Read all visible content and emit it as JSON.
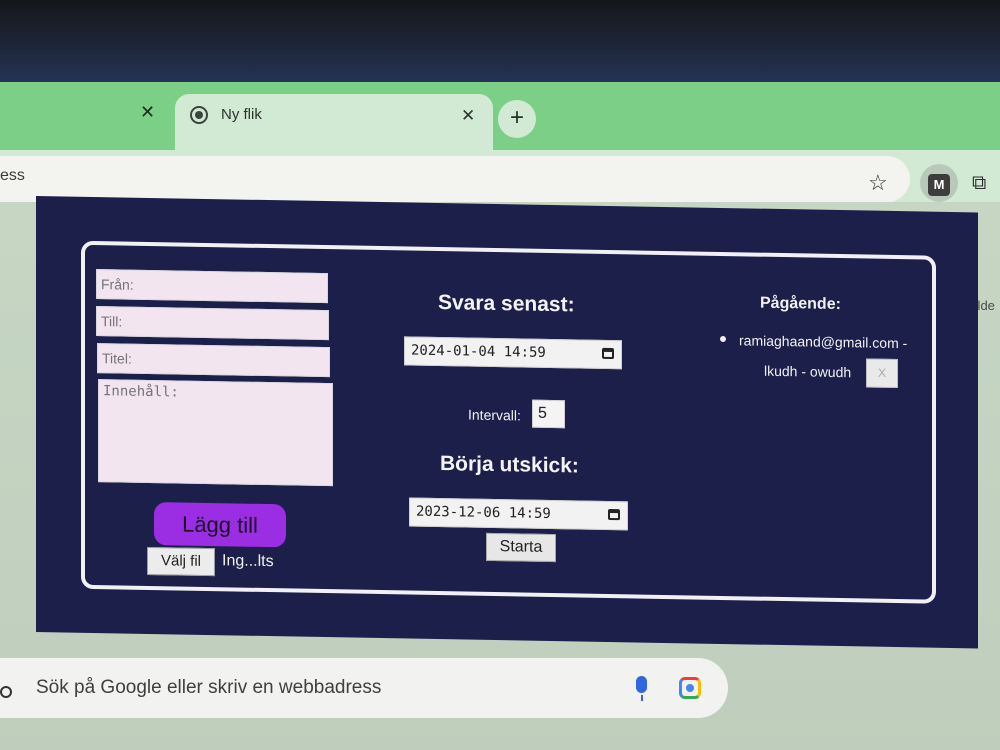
{
  "browser": {
    "tabs": [
      {
        "label": ""
      },
      {
        "label": "Ny flik"
      }
    ],
    "address_bar_text": "ess",
    "side_text": "Bilde"
  },
  "form": {
    "from_placeholder": "Från:",
    "to_placeholder": "Till:",
    "title_placeholder": "Titel:",
    "content_placeholder": "Innehåll:",
    "add_button": "Lägg till",
    "file_button": "Välj fil",
    "file_status": "Ing...lts"
  },
  "schedule": {
    "reply_by_heading": "Svara senast:",
    "reply_by_value": "2024-01-04  14:59",
    "interval_label": "Intervall:",
    "interval_value": "5",
    "start_heading": "Börja utskick:",
    "start_value": "2023-12-06  14:59",
    "start_button": "Starta"
  },
  "ongoing": {
    "heading": "Pågående:",
    "items": [
      {
        "line1": "ramiaghaand@gmail.com -",
        "line2": "lkudh - owudh",
        "delete_label": "X"
      }
    ]
  },
  "newtab_search": {
    "placeholder": "Sök på Google eller skriv en webbadress"
  },
  "colors": {
    "app_background": "#1b1f4a",
    "add_button": "#9b2de3",
    "tab_strip": "#7ccf87"
  }
}
